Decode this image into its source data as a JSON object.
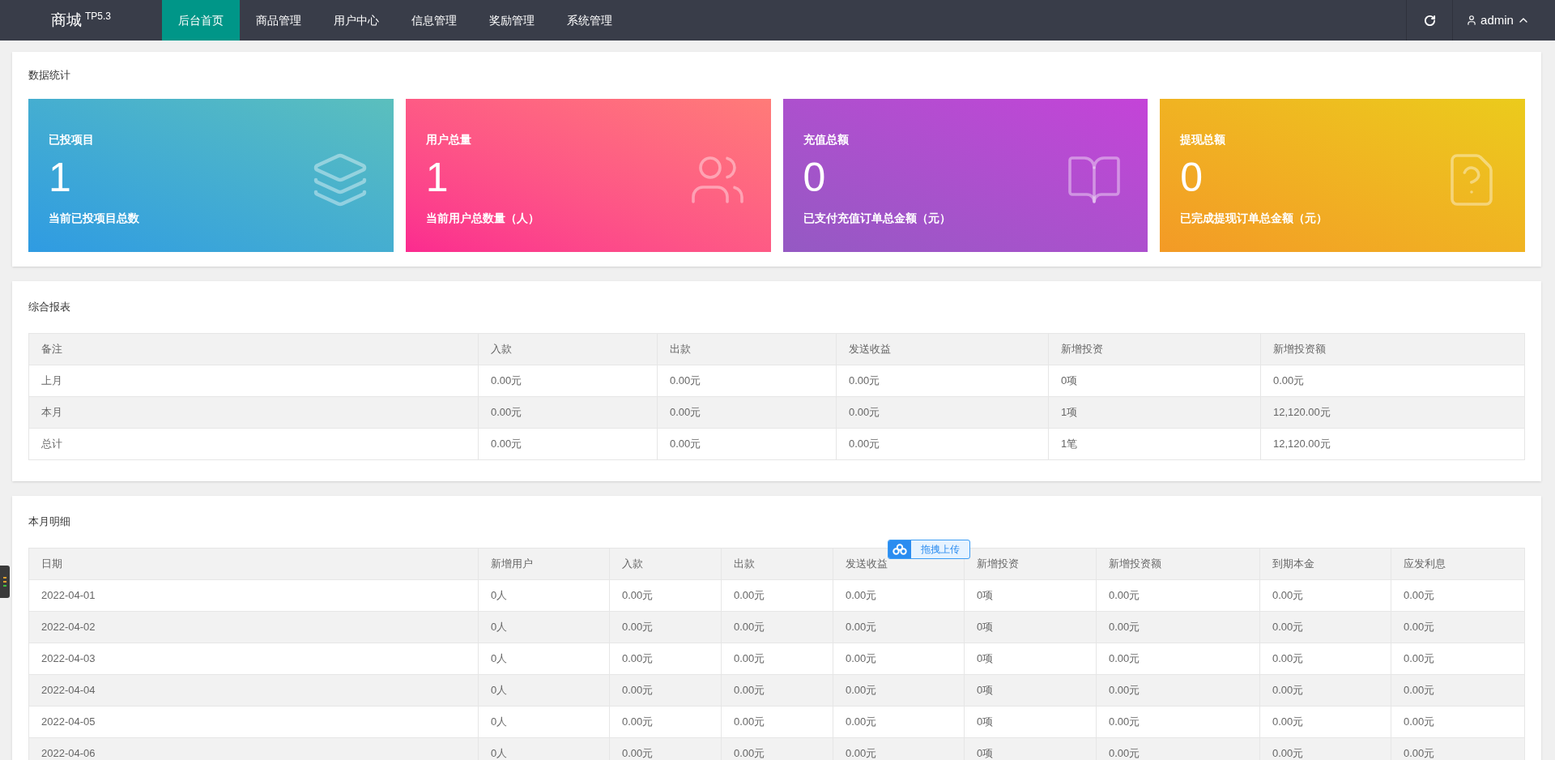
{
  "header": {
    "logo": "商城",
    "version": "TP5.3",
    "tabs": [
      {
        "label": "后台首页",
        "selected": true
      },
      {
        "label": "商品管理",
        "selected": false
      },
      {
        "label": "用户中心",
        "selected": false
      },
      {
        "label": "信息管理",
        "selected": false
      },
      {
        "label": "奖励管理",
        "selected": false
      },
      {
        "label": "系统管理",
        "selected": false
      }
    ],
    "user": "admin"
  },
  "stats": {
    "title": "数据统计",
    "cards": [
      {
        "kind": "layers",
        "title": "已投项目",
        "value": "1",
        "caption": "当前已投项目总数"
      },
      {
        "kind": "users",
        "title": "用户总量",
        "value": "1",
        "caption": "当前用户总数量（人）"
      },
      {
        "kind": "book",
        "title": "充值总额",
        "value": "0",
        "caption": "已支付充值订单总金额（元）"
      },
      {
        "kind": "question",
        "title": "提现总额",
        "value": "0",
        "caption": "已完成提现订单总金额（元）"
      }
    ]
  },
  "report": {
    "title": "综合报表",
    "columns": [
      "备注",
      "入款",
      "出款",
      "发送收益",
      "新增投资",
      "新增投资额"
    ],
    "rows": [
      [
        "上月",
        "0.00元",
        "0.00元",
        "0.00元",
        "0项",
        "0.00元"
      ],
      [
        "本月",
        "0.00元",
        "0.00元",
        "0.00元",
        "1项",
        "12,120.00元"
      ],
      [
        "总计",
        "0.00元",
        "0.00元",
        "0.00元",
        "1笔",
        "12,120.00元"
      ]
    ]
  },
  "monthly": {
    "title": "本月明细",
    "columns": [
      "日期",
      "新增用户",
      "入款",
      "出款",
      "发送收益",
      "新增投资",
      "新增投资额",
      "到期本金",
      "应发利息"
    ],
    "rows": [
      [
        "2022-04-01",
        "0人",
        "0.00元",
        "0.00元",
        "0.00元",
        "0项",
        "0.00元",
        "0.00元",
        "0.00元"
      ],
      [
        "2022-04-02",
        "0人",
        "0.00元",
        "0.00元",
        "0.00元",
        "0项",
        "0.00元",
        "0.00元",
        "0.00元"
      ],
      [
        "2022-04-03",
        "0人",
        "0.00元",
        "0.00元",
        "0.00元",
        "0项",
        "0.00元",
        "0.00元",
        "0.00元"
      ],
      [
        "2022-04-04",
        "0人",
        "0.00元",
        "0.00元",
        "0.00元",
        "0项",
        "0.00元",
        "0.00元",
        "0.00元"
      ],
      [
        "2022-04-05",
        "0人",
        "0.00元",
        "0.00元",
        "0.00元",
        "0项",
        "0.00元",
        "0.00元",
        "0.00元"
      ],
      [
        "2022-04-06",
        "0人",
        "0.00元",
        "0.00元",
        "0.00元",
        "0项",
        "0.00元",
        "0.00元",
        "0.00元"
      ]
    ]
  },
  "upload_badge": "拖拽上传"
}
